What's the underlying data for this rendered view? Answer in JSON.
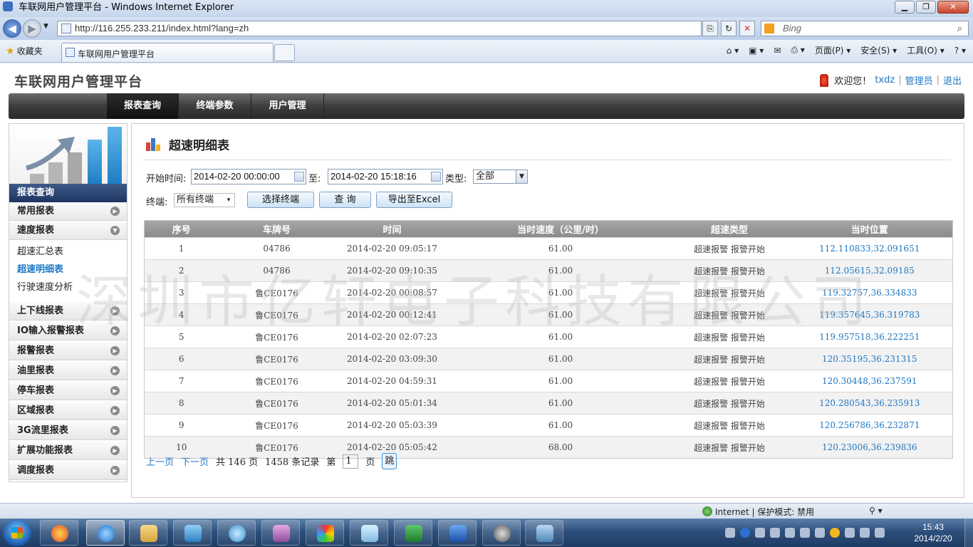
{
  "browser": {
    "window_title": "车联网用户管理平台 - Windows Internet Explorer",
    "url": "http://116.255.233.211/index.html?lang=zh",
    "search_placeholder": "Bing",
    "favorites_label": "收藏夹",
    "tab_title": "车联网用户管理平台",
    "menu": {
      "page": "页面(P)",
      "safety": "安全(S)",
      "tools": "工具(O)"
    },
    "status_zone": "Internet | 保护模式: 禁用",
    "clock_time": "15:43",
    "clock_date": "2014/2/20"
  },
  "app": {
    "title": "车联网用户管理平台",
    "welcome": "欢迎您！",
    "user": "txdz",
    "role": "管理员",
    "logout": "退出"
  },
  "nav": {
    "reports": "报表查询",
    "terminal_params": "终端参数",
    "user_mgmt": "用户管理"
  },
  "sidebar": {
    "header": "报表查询",
    "common": "常用报表",
    "speed": "速度报表",
    "sub_speed_summary": "超速汇总表",
    "sub_speed_detail": "超速明细表",
    "sub_speed_analysis": "行驶速度分析",
    "online": "上下线报表",
    "io": "IO输入报警报表",
    "alarm": "报警报表",
    "fuel": "油里报表",
    "parking": "停车报表",
    "area": "区域报表",
    "g3": "3G流里报表",
    "ext": "扩展功能报表",
    "dispatch": "调度报表"
  },
  "report": {
    "title": "超速明细表",
    "start_label": "开始时间:",
    "start_value": "2014-02-20 00:00:00",
    "to_label": "至:",
    "end_value": "2014-02-20 15:18:16",
    "type_label": "类型:",
    "type_value": "全部",
    "terminal_label": "终端:",
    "terminal_value": "所有终端",
    "btn_select": "选择终端",
    "btn_query": "查 询",
    "btn_export": "导出至Excel"
  },
  "table": {
    "headers": [
      "序号",
      "车牌号",
      "时间",
      "当时速度（公里/时）",
      "超速类型",
      "当时位置"
    ],
    "rows": [
      [
        "1",
        "04786",
        "2014-02-20 09:05:17",
        "61.00",
        "超速报警 报警开始",
        "112.110833,32.091651"
      ],
      [
        "2",
        "04786",
        "2014-02-20 09:10:35",
        "61.00",
        "超速报警 报警开始",
        "112.05615,32.09185"
      ],
      [
        "3",
        "鲁CE0176",
        "2014-02-20 00:08:57",
        "61.00",
        "超速报警 报警开始",
        "119.32757,36.334833"
      ],
      [
        "4",
        "鲁CE0176",
        "2014-02-20 00:12:41",
        "61.00",
        "超速报警 报警开始",
        "119.357645,36.319783"
      ],
      [
        "5",
        "鲁CE0176",
        "2014-02-20 02:07:23",
        "61.00",
        "超速报警 报警开始",
        "119.957518,36.222251"
      ],
      [
        "6",
        "鲁CE0176",
        "2014-02-20 03:09:30",
        "61.00",
        "超速报警 报警开始",
        "120.35195,36.231315"
      ],
      [
        "7",
        "鲁CE0176",
        "2014-02-20 04:59:31",
        "61.00",
        "超速报警 报警开始",
        "120.30448,36.237591"
      ],
      [
        "8",
        "鲁CE0176",
        "2014-02-20 05:01:34",
        "61.00",
        "超速报警 报警开始",
        "120.280543,36.235913"
      ],
      [
        "9",
        "鲁CE0176",
        "2014-02-20 05:03:39",
        "61.00",
        "超速报警 报警开始",
        "120.256786,36.232871"
      ],
      [
        "10",
        "鲁CE0176",
        "2014-02-20 05:05:42",
        "68.00",
        "超速报警 报警开始",
        "120.23006,36.239836"
      ]
    ]
  },
  "pager": {
    "prev": "上一页",
    "next": "下一页",
    "total_pages": "共 146 页",
    "total_records": "1458 条记录",
    "page_prefix": "第",
    "current_page": "1",
    "page_suffix": "页",
    "go": "跳"
  },
  "watermark": "深圳市亿轩电子科技有限公司",
  "colors": {
    "link": "#1d77c4",
    "nav_bg": "#3d3d3d",
    "sidebar_header": "#1e3561",
    "table_header": "#9a9a9a"
  }
}
